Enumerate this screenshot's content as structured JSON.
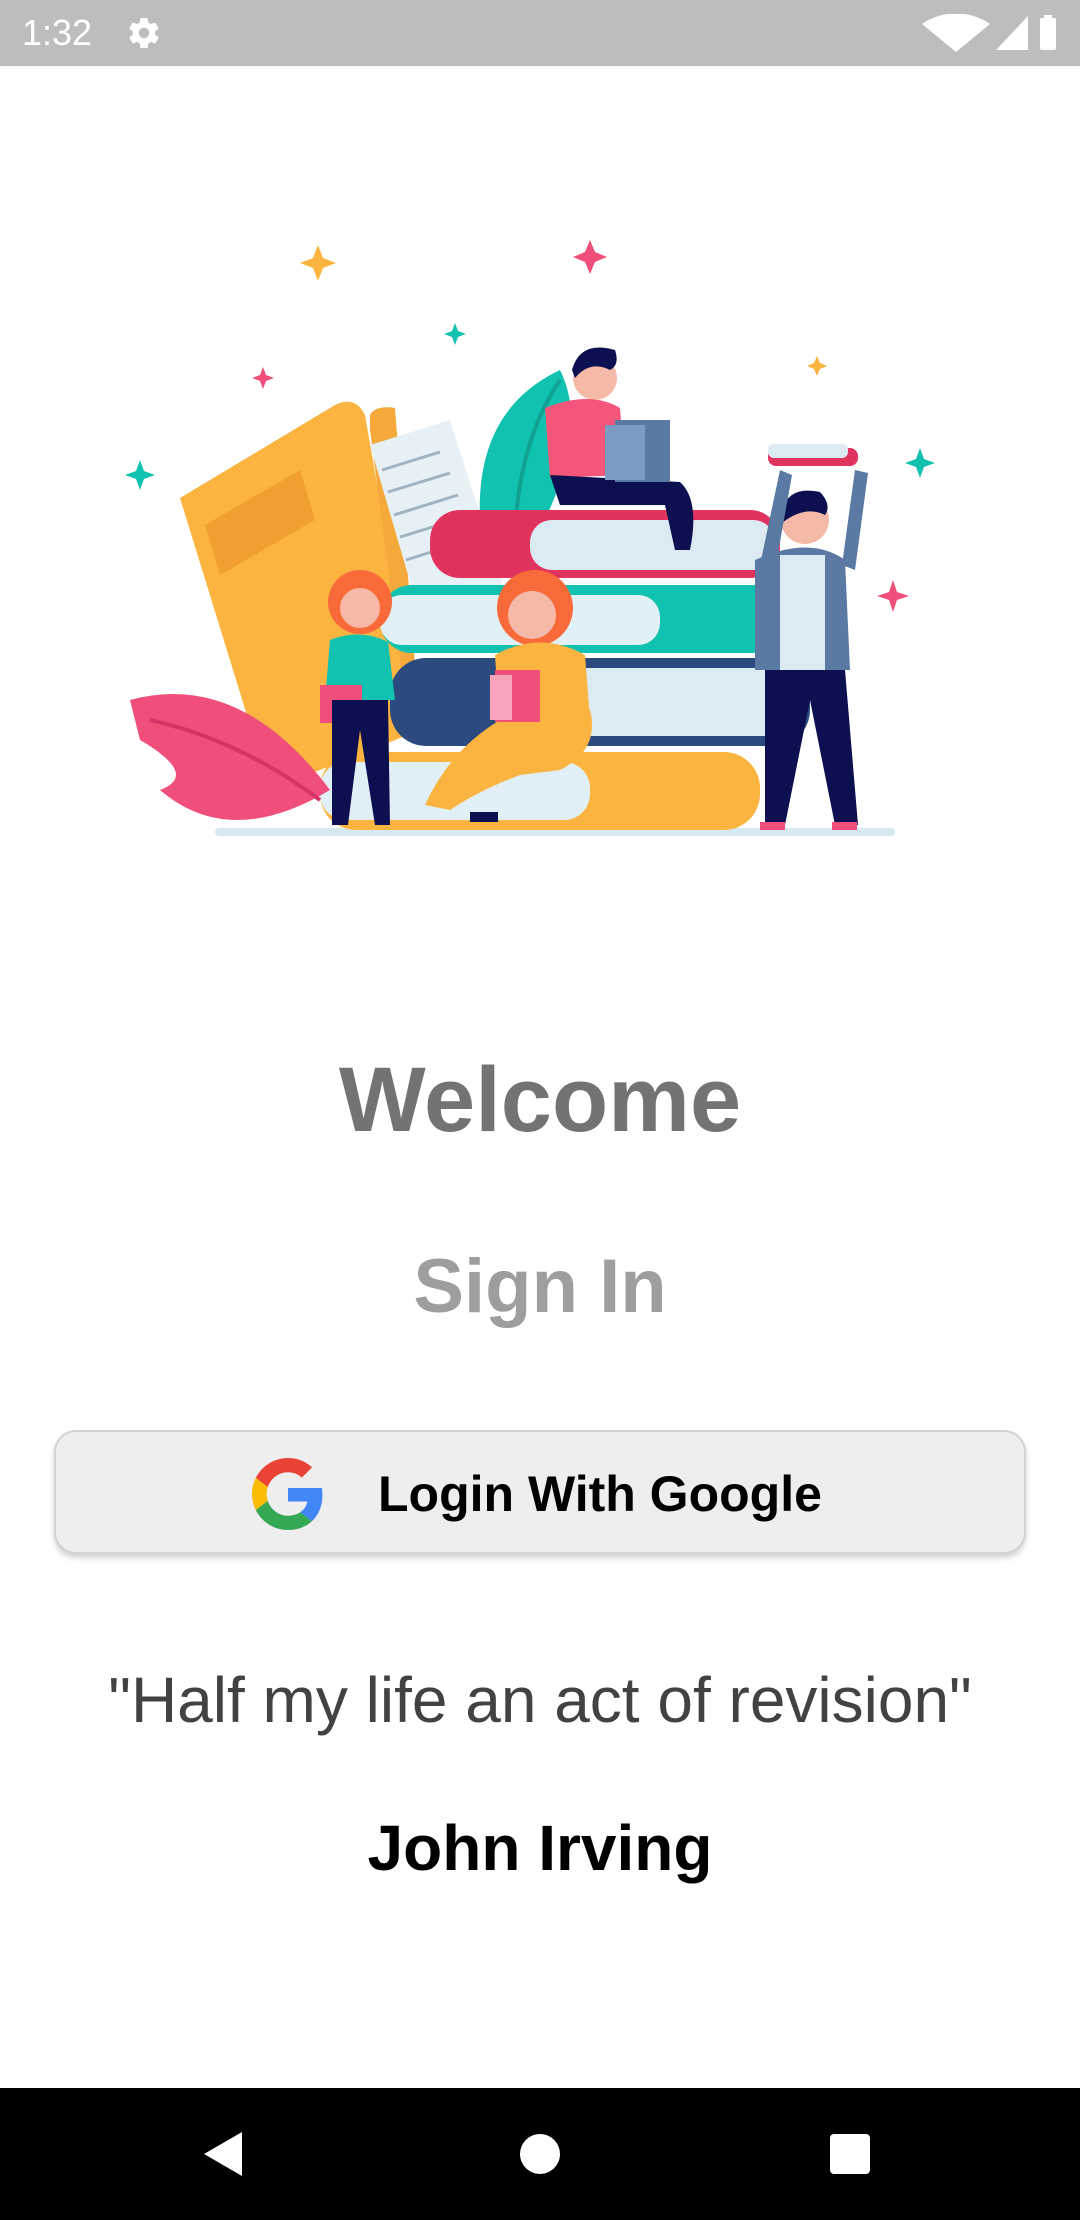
{
  "status_bar": {
    "time": "1:32",
    "icons": [
      "gear-icon",
      "wifi-icon",
      "signal-icon",
      "battery-icon"
    ]
  },
  "welcome": {
    "title": "Welcome",
    "subtitle": "Sign In"
  },
  "login": {
    "button_label": "Login With Google",
    "icon": "google-logo-icon"
  },
  "quote": {
    "text": "\"Half my life an act of revision\"",
    "author": "John Irving"
  },
  "nav_bar": {
    "icons": [
      "back-icon",
      "home-icon",
      "recents-icon"
    ]
  },
  "colors": {
    "status_bar": "#bdbdbd",
    "welcome_text": "#737373",
    "signin_text": "#9e9e9e",
    "button_bg": "#eeeeee",
    "nav_bar": "#000000",
    "illustration_yellow": "#fbb43f",
    "illustration_teal": "#12c2b0",
    "illustration_pink": "#ef4f7a",
    "illustration_navy": "#0d1050"
  }
}
